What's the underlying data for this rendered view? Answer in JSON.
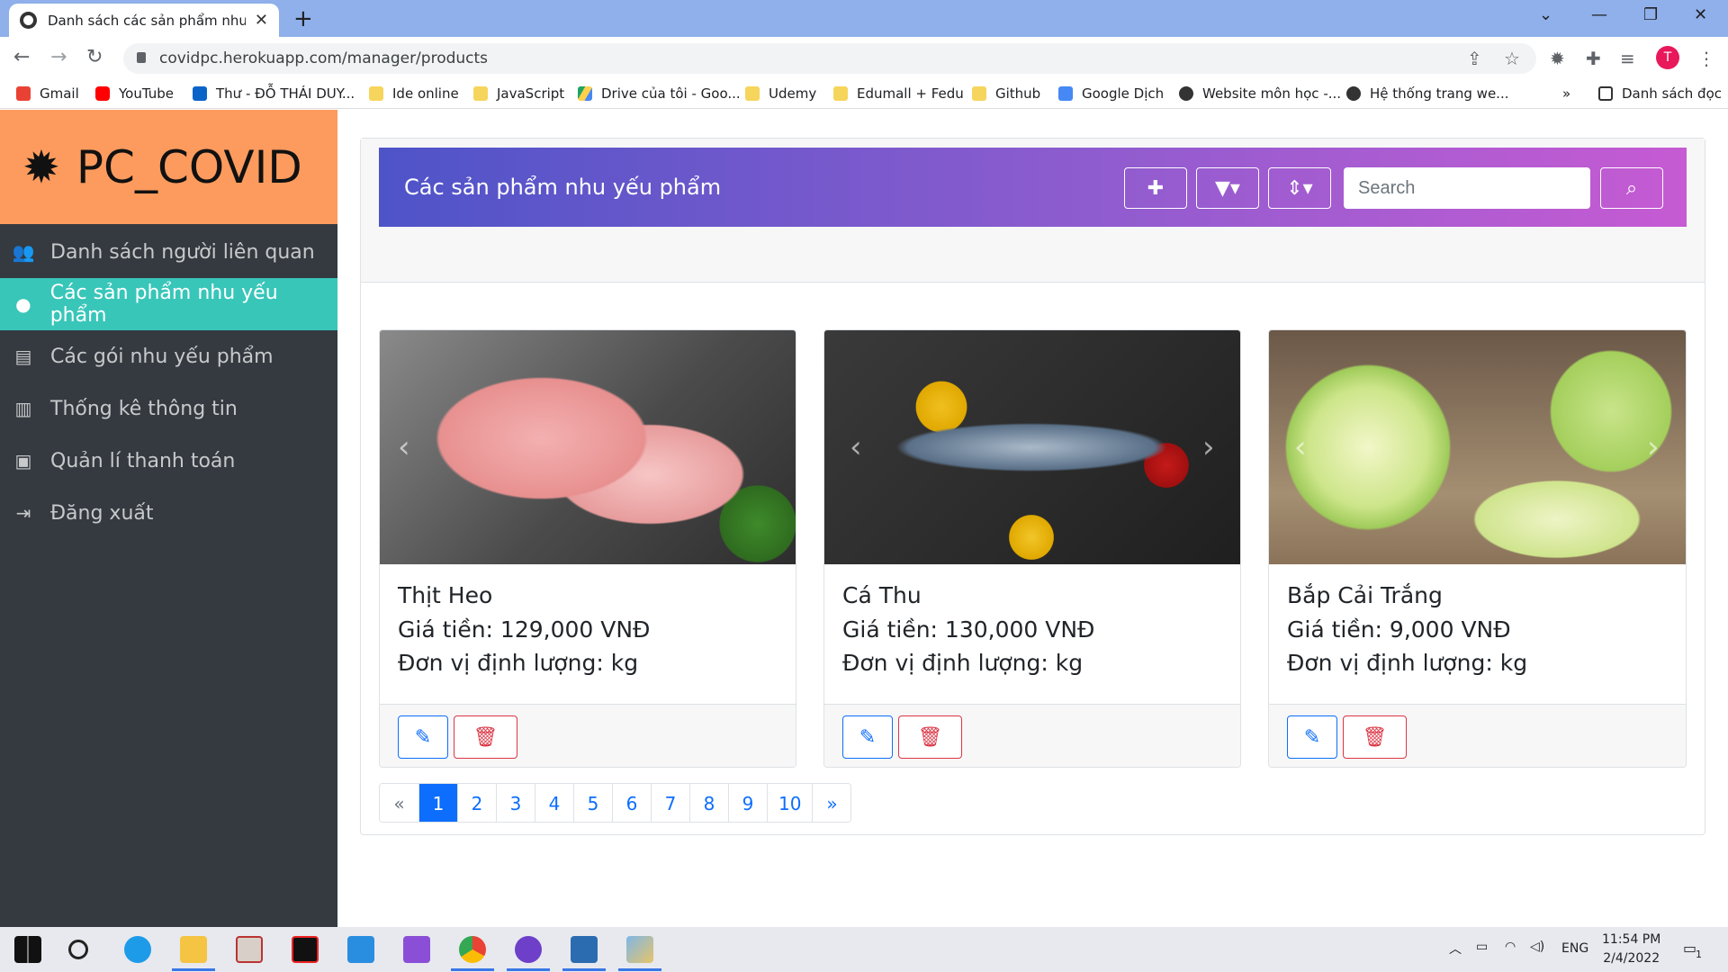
{
  "browser": {
    "tab_title": "Danh sách các sản phẩm nhu yếu phẩm",
    "tab_close": "✕",
    "new_tab": "+",
    "url": "covidpc.herokuapp.com/manager/products",
    "profile_initial": "T",
    "bookmarks": [
      {
        "label": "Gmail",
        "icon": "gmail-icon"
      },
      {
        "label": "YouTube",
        "icon": "youtube-icon"
      },
      {
        "label": "Thư - ĐỖ THÁI DUY...",
        "icon": "outlook-icon"
      },
      {
        "label": "Ide online",
        "icon": "folder-icon"
      },
      {
        "label": "JavaScript",
        "icon": "folder-icon"
      },
      {
        "label": "Drive của tôi - Goo...",
        "icon": "drive-icon"
      },
      {
        "label": "Udemy",
        "icon": "folder-icon"
      },
      {
        "label": "Edumall + Fedu",
        "icon": "folder-icon"
      },
      {
        "label": "Github",
        "icon": "folder-icon"
      },
      {
        "label": "Google Dịch",
        "icon": "google-translate-icon"
      },
      {
        "label": "Website môn học -...",
        "icon": "globe-icon"
      },
      {
        "label": "Hệ thống trang we...",
        "icon": "globe-icon"
      }
    ],
    "more_bookmarks": "»",
    "reading_list": "Danh sách đọc"
  },
  "sidebar": {
    "brand": "PC_COVID",
    "items": [
      {
        "label": "Danh sách người liên quan",
        "icon": "users-icon",
        "active": false
      },
      {
        "label": "Các sản phẩm nhu yếu phẩm",
        "icon": "cookie-icon",
        "active": true
      },
      {
        "label": "Các gói nhu yếu phẩm",
        "icon": "archive-icon",
        "active": false
      },
      {
        "label": "Thống kê thông tin",
        "icon": "chart-icon",
        "active": false
      },
      {
        "label": "Quản lí thanh toán",
        "icon": "money-icon",
        "active": false
      },
      {
        "label": "Đăng xuất",
        "icon": "logout-icon",
        "active": false
      }
    ]
  },
  "header": {
    "title": "Các sản phẩm nhu yếu phẩm",
    "search_placeholder": "Search"
  },
  "products": [
    {
      "name": "Thịt Heo",
      "price": "Giá tiền: 129,000 VNĐ",
      "unit": "Đơn vị định lượng: kg",
      "image": "pork"
    },
    {
      "name": "Cá Thu",
      "price": "Giá tiền: 130,000 VNĐ",
      "unit": "Đơn vị định lượng: kg",
      "image": "mackerel"
    },
    {
      "name": "Bắp Cải Trắng",
      "price": "Giá tiền: 9,000 VNĐ",
      "unit": "Đơn vị định lượng: kg",
      "image": "cabbage"
    }
  ],
  "pagination": {
    "prev": "«",
    "pages": [
      "1",
      "2",
      "3",
      "4",
      "5",
      "6",
      "7",
      "8",
      "9",
      "10"
    ],
    "current": "1",
    "next": "»"
  },
  "taskbar": {
    "lang": "ENG",
    "time": "11:54 PM",
    "date": "2/4/2022",
    "notifications": "1"
  },
  "colors": {
    "sidebar_bg": "#343a40",
    "brand_bg": "#fd9b5e",
    "active_item": "#38c6b9",
    "header_gradient_start": "#4e54c8",
    "header_gradient_end": "#c65bd3",
    "primary": "#0d6efd",
    "danger": "#dc3545"
  }
}
